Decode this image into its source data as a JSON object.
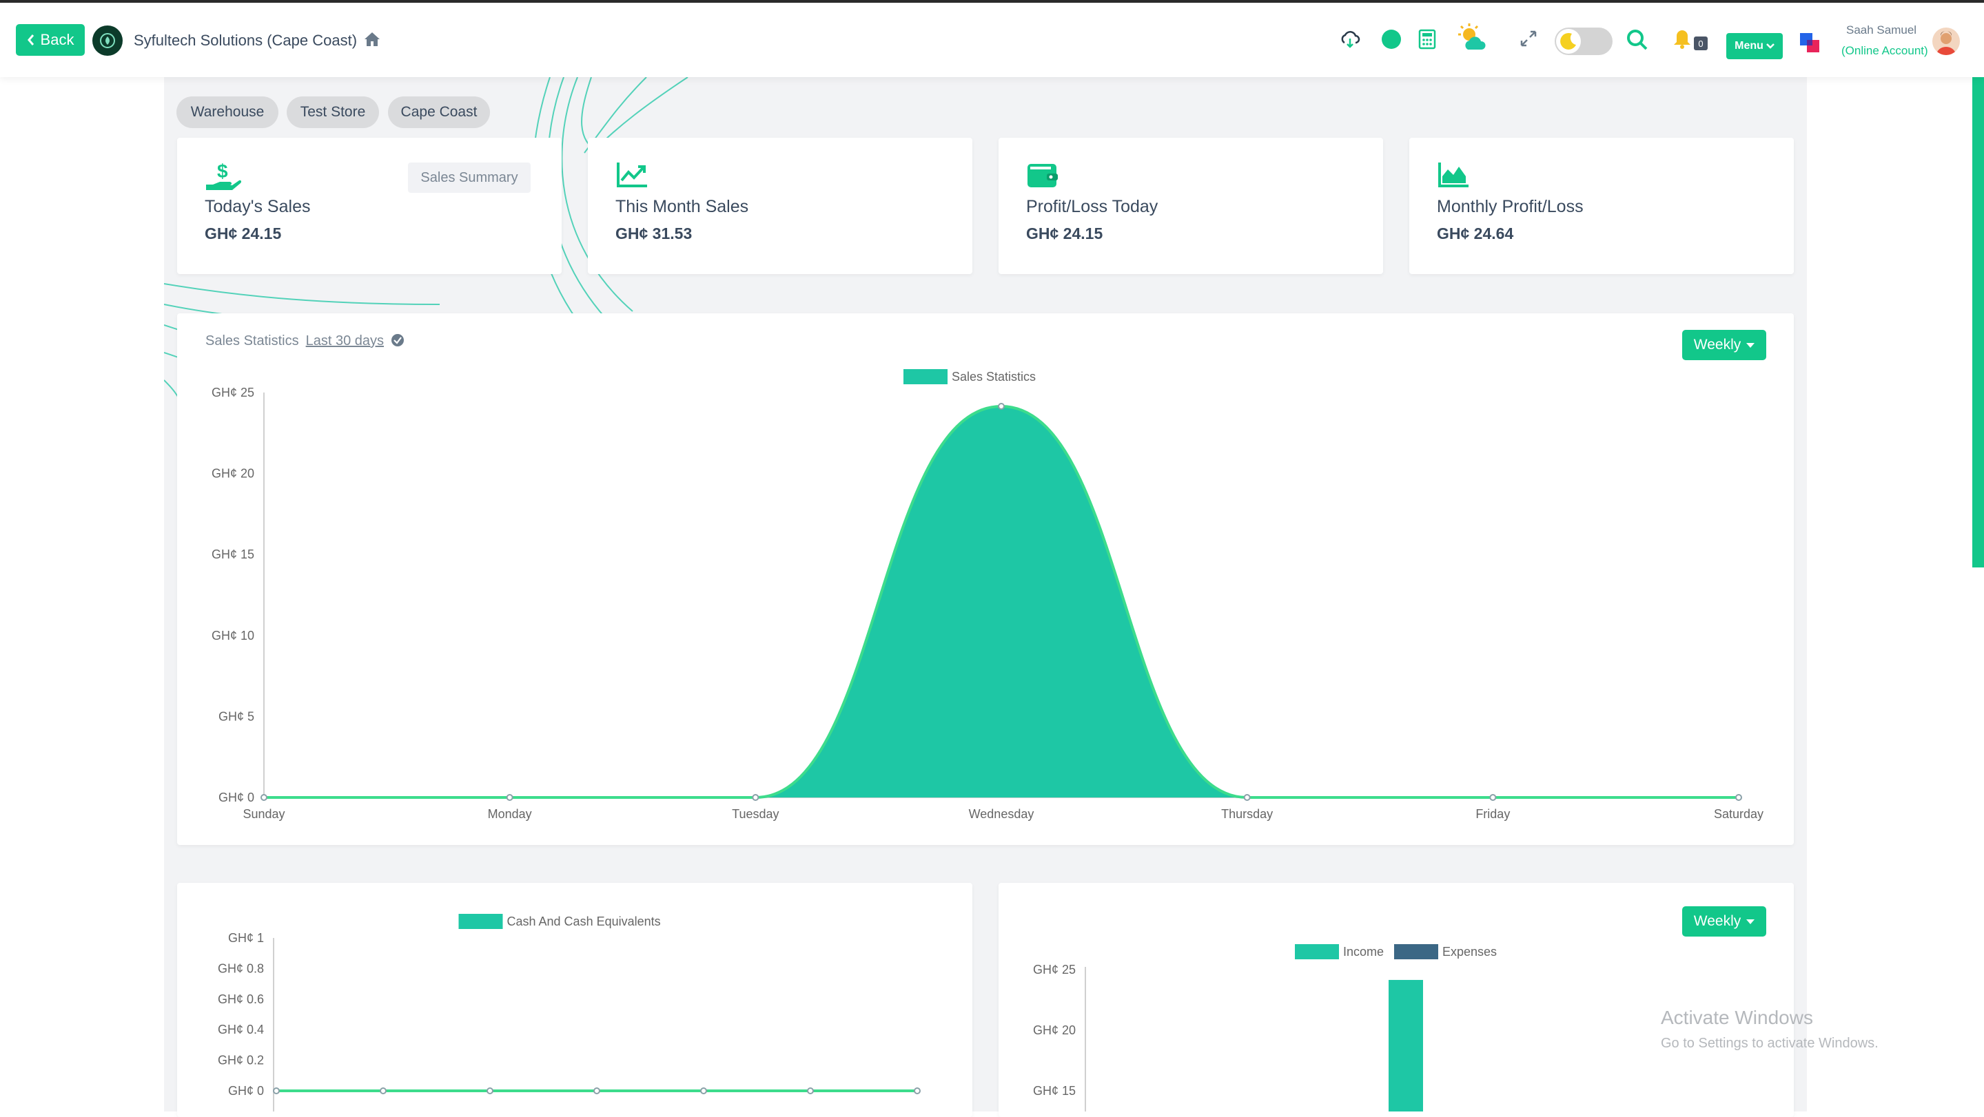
{
  "header": {
    "back_label": "Back",
    "company_name": "Syfultech Solutions (Cape Coast)",
    "menu_label": "Menu",
    "notification_count": "0",
    "user_name": "Saah Samuel",
    "user_account": "(Online Account)"
  },
  "stores": [
    "Warehouse",
    "Test Store",
    "Cape Coast"
  ],
  "stats": [
    {
      "label": "Today's Sales",
      "value": "GH¢ 24.15",
      "icon": "hand-dollar-icon"
    },
    {
      "label": "This Month Sales",
      "value": "GH¢ 31.53",
      "icon": "trend-chart-icon"
    },
    {
      "label": "Profit/Loss Today",
      "value": "GH¢ 24.15",
      "icon": "wallet-icon"
    },
    {
      "label": "Monthly Profit/Loss",
      "value": "GH¢ 24.64",
      "icon": "area-chart-icon"
    }
  ],
  "sales_summary_label": "Sales Summary",
  "sales_chart": {
    "heading": "Sales Statistics",
    "period_link": "Last 30 days",
    "weekly_label": "Weekly"
  },
  "income_chart": {
    "weekly_label": "Weekly"
  },
  "watermark": {
    "title": "Activate Windows",
    "subtitle": "Go to Settings to activate Windows."
  },
  "colors": {
    "accent": "#12c78a",
    "sales_fill": "#1ec7a5",
    "income": "#1ec7a5",
    "expenses": "#3b6785"
  },
  "chart_data": [
    {
      "type": "area",
      "title": "",
      "legend": [
        "Sales Statistics"
      ],
      "categories": [
        "Sunday",
        "Monday",
        "Tuesday",
        "Wednesday",
        "Thursday",
        "Friday",
        "Saturday"
      ],
      "series": [
        {
          "name": "Sales Statistics",
          "values": [
            0,
            0,
            0,
            24.15,
            0,
            0,
            0
          ]
        }
      ],
      "yticks": [
        "GH¢ 0",
        "GH¢ 5",
        "GH¢ 10",
        "GH¢ 15",
        "GH¢ 20",
        "GH¢ 25"
      ],
      "ylim": [
        0,
        25
      ],
      "grid": false,
      "legend_position": "top-center"
    },
    {
      "type": "line",
      "title": "",
      "legend": [
        "Cash And Cash Equivalents"
      ],
      "x_count": 7,
      "series": [
        {
          "name": "Cash And Cash Equivalents",
          "values": [
            0,
            0,
            0,
            0,
            0,
            0,
            0
          ]
        }
      ],
      "yticks": [
        "GH¢ 0",
        "GH¢ 0.2",
        "GH¢ 0.4",
        "GH¢ 0.6",
        "GH¢ 0.8",
        "GH¢ 1"
      ],
      "ylim": [
        0,
        1
      ],
      "grid": false,
      "legend_position": "top-center"
    },
    {
      "type": "bar",
      "title": "",
      "legend": [
        "Income",
        "Expenses"
      ],
      "series": [
        {
          "name": "Income",
          "values": [
            24.15
          ]
        },
        {
          "name": "Expenses",
          "values": [
            0
          ]
        }
      ],
      "yticks": [
        "GH¢ 15",
        "GH¢ 20",
        "GH¢ 25"
      ],
      "ylim": [
        0,
        25
      ],
      "grid": false,
      "legend_position": "top-center"
    }
  ]
}
